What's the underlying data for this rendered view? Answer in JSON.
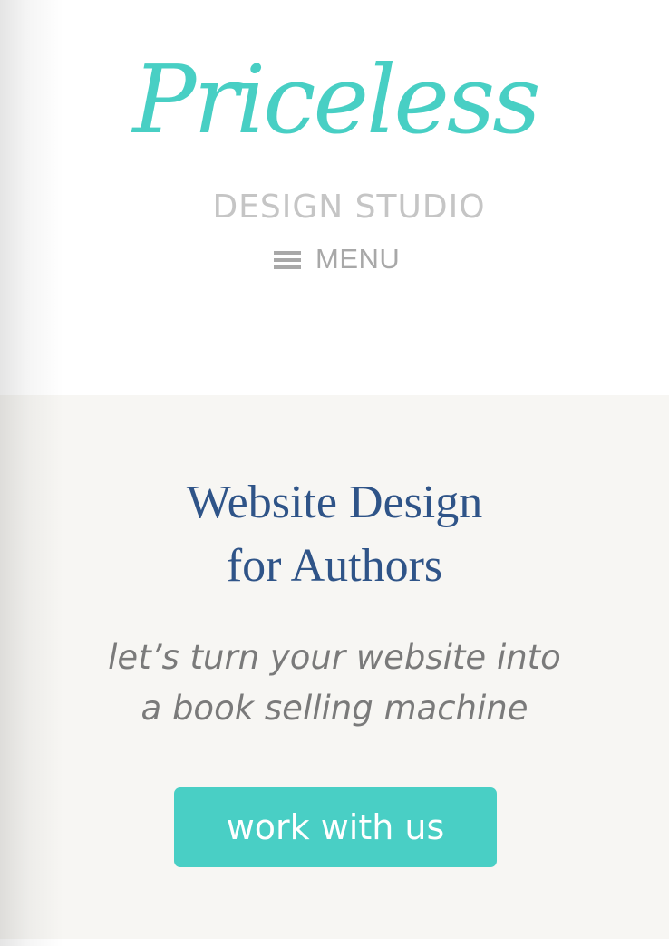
{
  "logo": {
    "script": "Priceless",
    "subtitle": "DESIGN STUDIO"
  },
  "nav": {
    "menu_label": "MENU",
    "menu_icon": "hamburger-icon"
  },
  "hero": {
    "title_line1": "Website Design",
    "title_line2": "for Authors",
    "tagline_line1": "let’s turn your website into",
    "tagline_line2": "a book selling machine",
    "cta_label": "work with us"
  },
  "colors": {
    "brand_teal": "#49cfc5",
    "title_blue": "#2f5488",
    "hero_background": "#f7f6f3",
    "muted_grey": "#a8a8a8"
  }
}
